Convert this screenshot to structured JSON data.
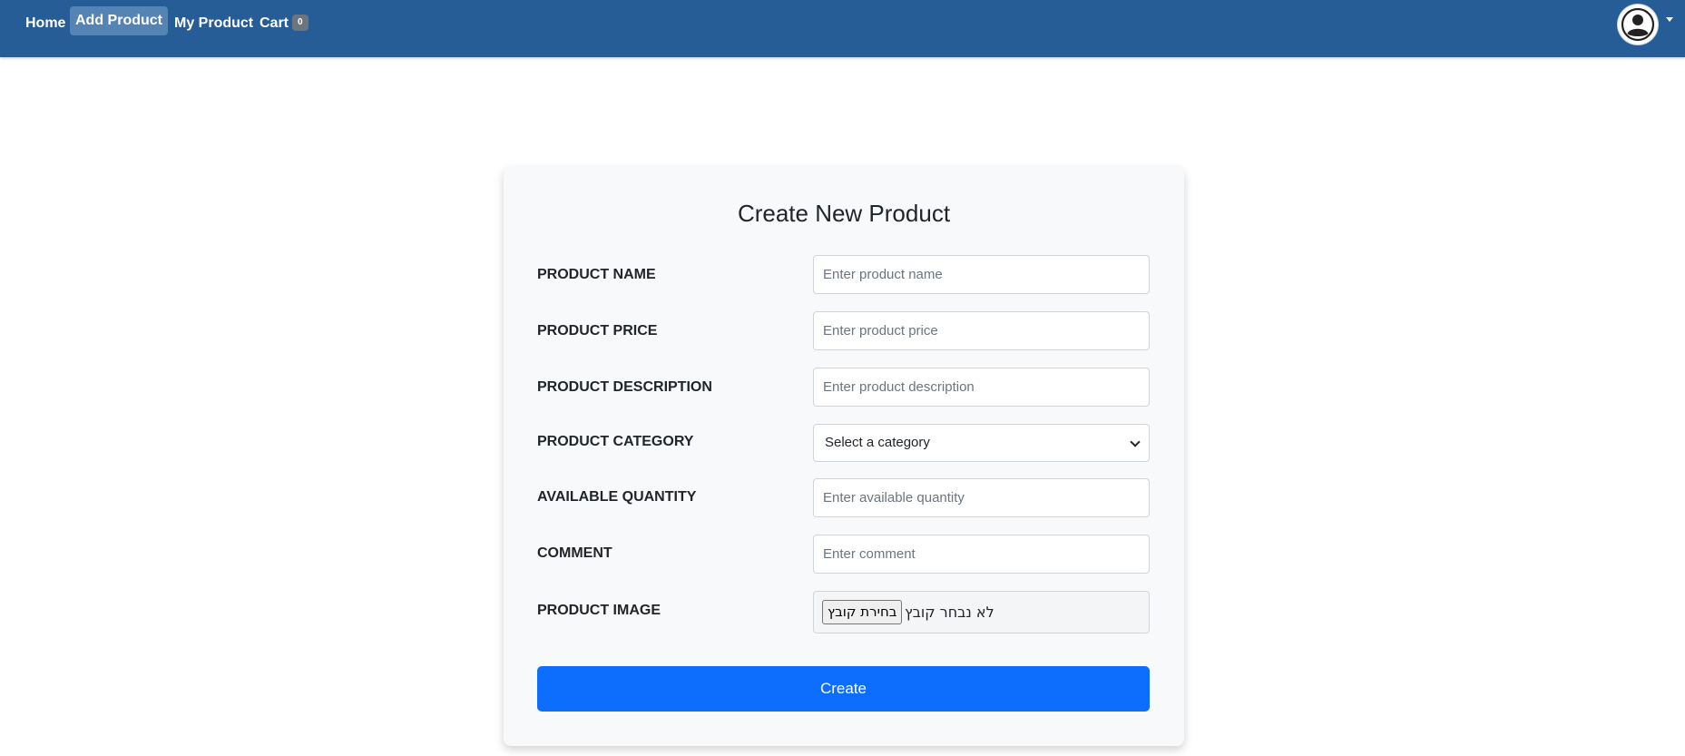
{
  "nav": {
    "home": "Home",
    "add_product": "Add Product",
    "my_product": "My Product",
    "cart": "Cart",
    "cart_count": "0",
    "avatar_icon": "user-circle-icon",
    "colors": {
      "bar": "#275d96",
      "active": "#5583b4"
    }
  },
  "form": {
    "title": "Create New Product",
    "name_label": "PRODUCT NAME",
    "name_placeholder": "Enter product name",
    "price_label": "PRODUCT PRICE",
    "price_placeholder": "Enter product price",
    "description_label": "PRODUCT DESCRIPTION",
    "description_placeholder": "Enter product description",
    "category_label": "PRODUCT CATEGORY",
    "category_selected": "Select a category",
    "quantity_label": "AVAILABLE QUANTITY",
    "quantity_placeholder": "Enter available quantity",
    "comment_label": "COMMENT",
    "comment_placeholder": "Enter comment",
    "image_label": "PRODUCT IMAGE",
    "file_button": "בחירת קובץ",
    "file_status": "לא נבחר קובץ",
    "submit": "Create",
    "colors": {
      "submit": "#0d6efd",
      "card": "#f8f9fa"
    }
  }
}
